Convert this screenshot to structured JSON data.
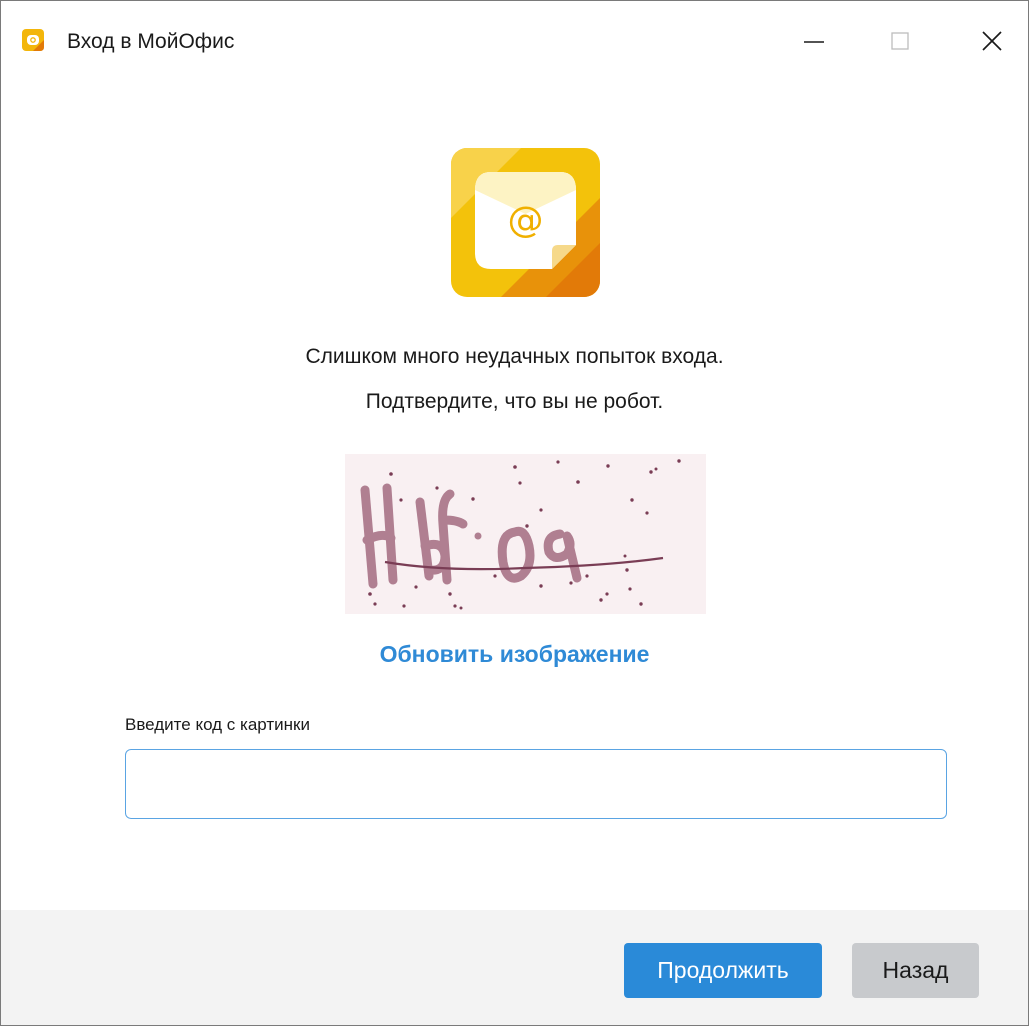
{
  "window": {
    "title": "Вход в МойОфис"
  },
  "colors": {
    "accent": "#2a8ad8",
    "link": "#2f8ad6",
    "input_border": "#5aa4e3",
    "footer_bg": "#f3f3f3",
    "secondary_button": "#c8cacd",
    "logo_yellow": "#f3c20b",
    "logo_orange": "#e27a08"
  },
  "icons": {
    "app": "myoffice-mail-icon",
    "logo": "mail-at-envelope-icon",
    "minimize": "minimize-icon",
    "maximize": "maximize-icon",
    "close": "close-icon"
  },
  "message": {
    "line1": "Слишком много неудачных попыток входа.",
    "line2": "Подтвердите, что вы не робот."
  },
  "captcha": {
    "code": "HbF09"
  },
  "refresh_link": "Обновить изображение",
  "code_field": {
    "label": "Введите код с картинки",
    "value": "",
    "placeholder": ""
  },
  "buttons": {
    "continue": "Продолжить",
    "back": "Назад"
  }
}
